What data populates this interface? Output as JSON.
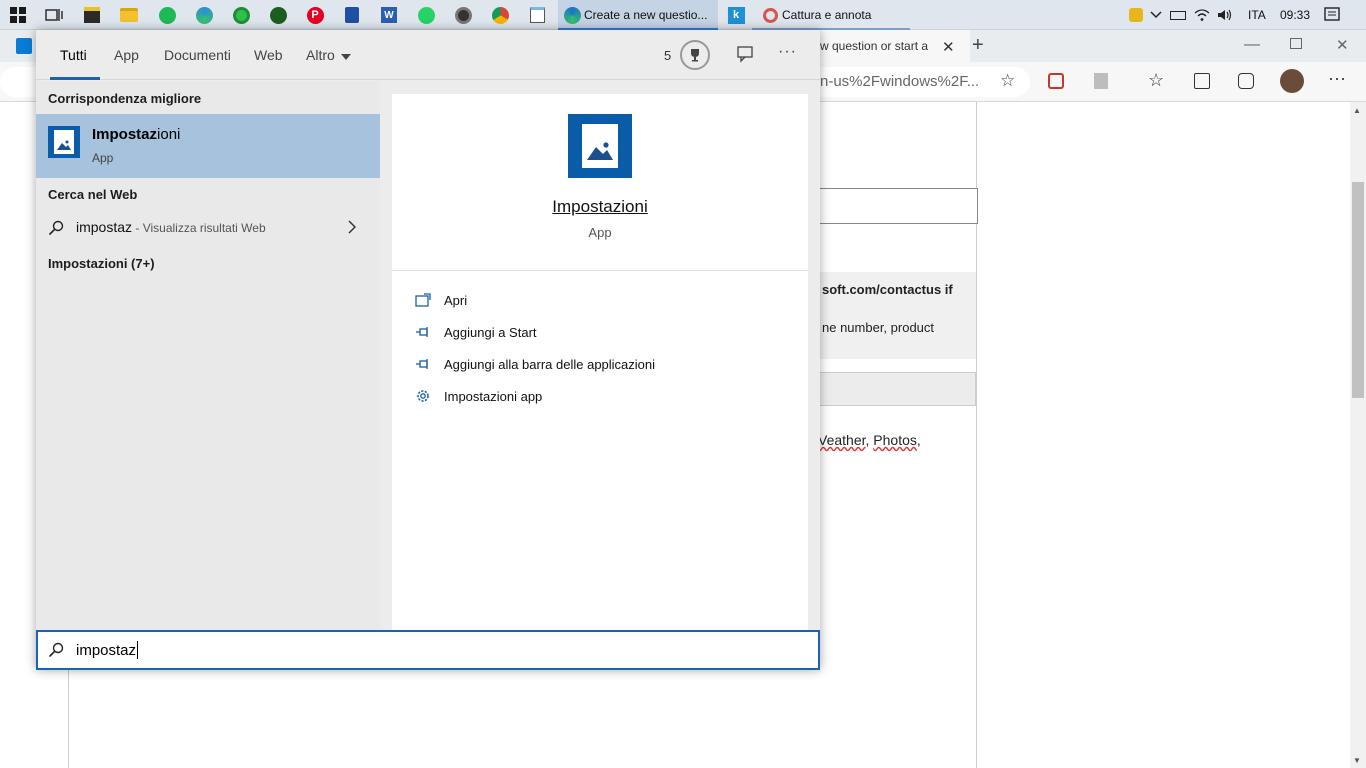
{
  "taskbar": {
    "window_buttons": [
      {
        "label": "Create a new questio..."
      },
      {
        "label": "Cattura e annota"
      }
    ],
    "tray": {
      "language": "ITA",
      "time": "09:33"
    }
  },
  "browser": {
    "tab_title": "w question or start a",
    "address": "n-us%2Fwindows%2F...",
    "content": {
      "line1": "soft.com/contactus if",
      "line2": "ne number, product",
      "line3_a": "Veather",
      "line3_b": "Photos"
    }
  },
  "search": {
    "tabs": [
      {
        "label": "Tutti",
        "active": true
      },
      {
        "label": "App"
      },
      {
        "label": "Documenti"
      },
      {
        "label": "Web"
      },
      {
        "label": "Altro"
      }
    ],
    "rewards_points": "5",
    "best_match_header": "Corrispondenza migliore",
    "best_match": {
      "title_bold": "Impostaz",
      "title_rest": "ioni",
      "subtitle": "App"
    },
    "web_header": "Cerca nel Web",
    "web_item": {
      "query": "impostaz",
      "suffix": " - Visualizza risultati Web"
    },
    "settings_header": "Impostazioni (7+)",
    "detail": {
      "title": "Impostazioni",
      "subtitle": "App",
      "actions": [
        {
          "label": "Apri",
          "icon": "open-icon"
        },
        {
          "label": "Aggiungi a Start",
          "icon": "pin-icon"
        },
        {
          "label": "Aggiungi alla barra delle applicazioni",
          "icon": "pin-icon"
        },
        {
          "label": "Impostazioni app",
          "icon": "gear-icon"
        }
      ]
    },
    "query": "impostaz"
  },
  "colors": {
    "accent": "#1a62b6",
    "selection": "#a6c2dc",
    "app_tile": "#0a5ca8"
  }
}
